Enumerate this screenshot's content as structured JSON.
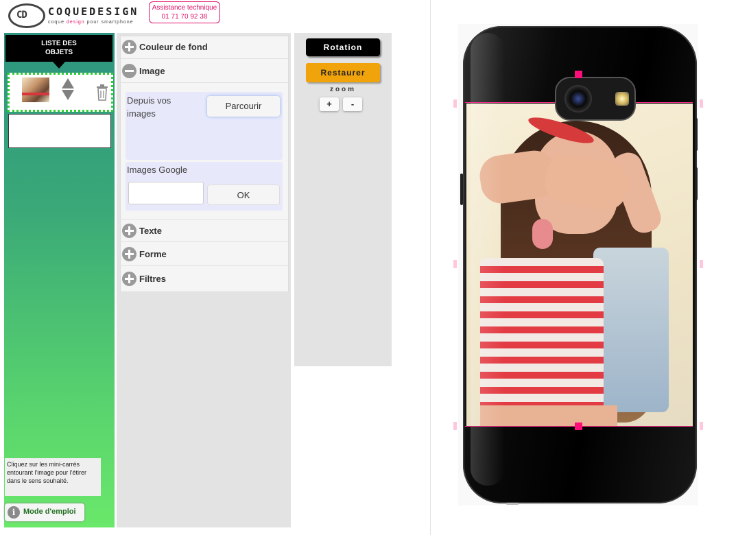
{
  "header": {
    "logo_mark": "CD",
    "brand": "COQUEDESIGN",
    "tagline_pre": "coque",
    "tagline_accent": "design",
    "tagline_post": "pour smartphone",
    "assist_title": "Assistance technique",
    "assist_phone": "01 71 70 92 38"
  },
  "objects_panel": {
    "header_line1": "LISTE DES",
    "header_line2": "OBJETS",
    "hint": "Cliquez sur les mini-carrés entourant l'image pour l'étirer dans le sens souhaité.",
    "mode_emploi": "Mode d'emploi",
    "info_glyph": "i"
  },
  "accordion": {
    "sections": [
      {
        "label": "Couleur de fond",
        "state": "collapsed"
      },
      {
        "label": "Image",
        "state": "expanded"
      },
      {
        "label": "Texte",
        "state": "collapsed"
      },
      {
        "label": "Forme",
        "state": "collapsed"
      },
      {
        "label": "Filtres",
        "state": "collapsed"
      }
    ],
    "image": {
      "from_images_label": "Depuis vos images",
      "browse_button": "Parcourir",
      "google_label": "Images Google",
      "google_query": "",
      "ok_button": "OK"
    }
  },
  "tools": {
    "rotation": "Rotation",
    "restaurer": "Restaurer",
    "zoom_label": "zoom",
    "zoom_in": "+",
    "zoom_out": "-"
  },
  "colors": {
    "accent_pink": "#e0116b",
    "handle_pink": "#ff0d78",
    "restore_orange": "#f0a30a",
    "selection_green": "#2ed22e"
  },
  "icons": {
    "expand": "plus-circle-icon",
    "collapse": "minus-circle-icon",
    "reorder": "up-down-arrows-icon",
    "delete": "trash-icon",
    "help": "info-icon"
  }
}
